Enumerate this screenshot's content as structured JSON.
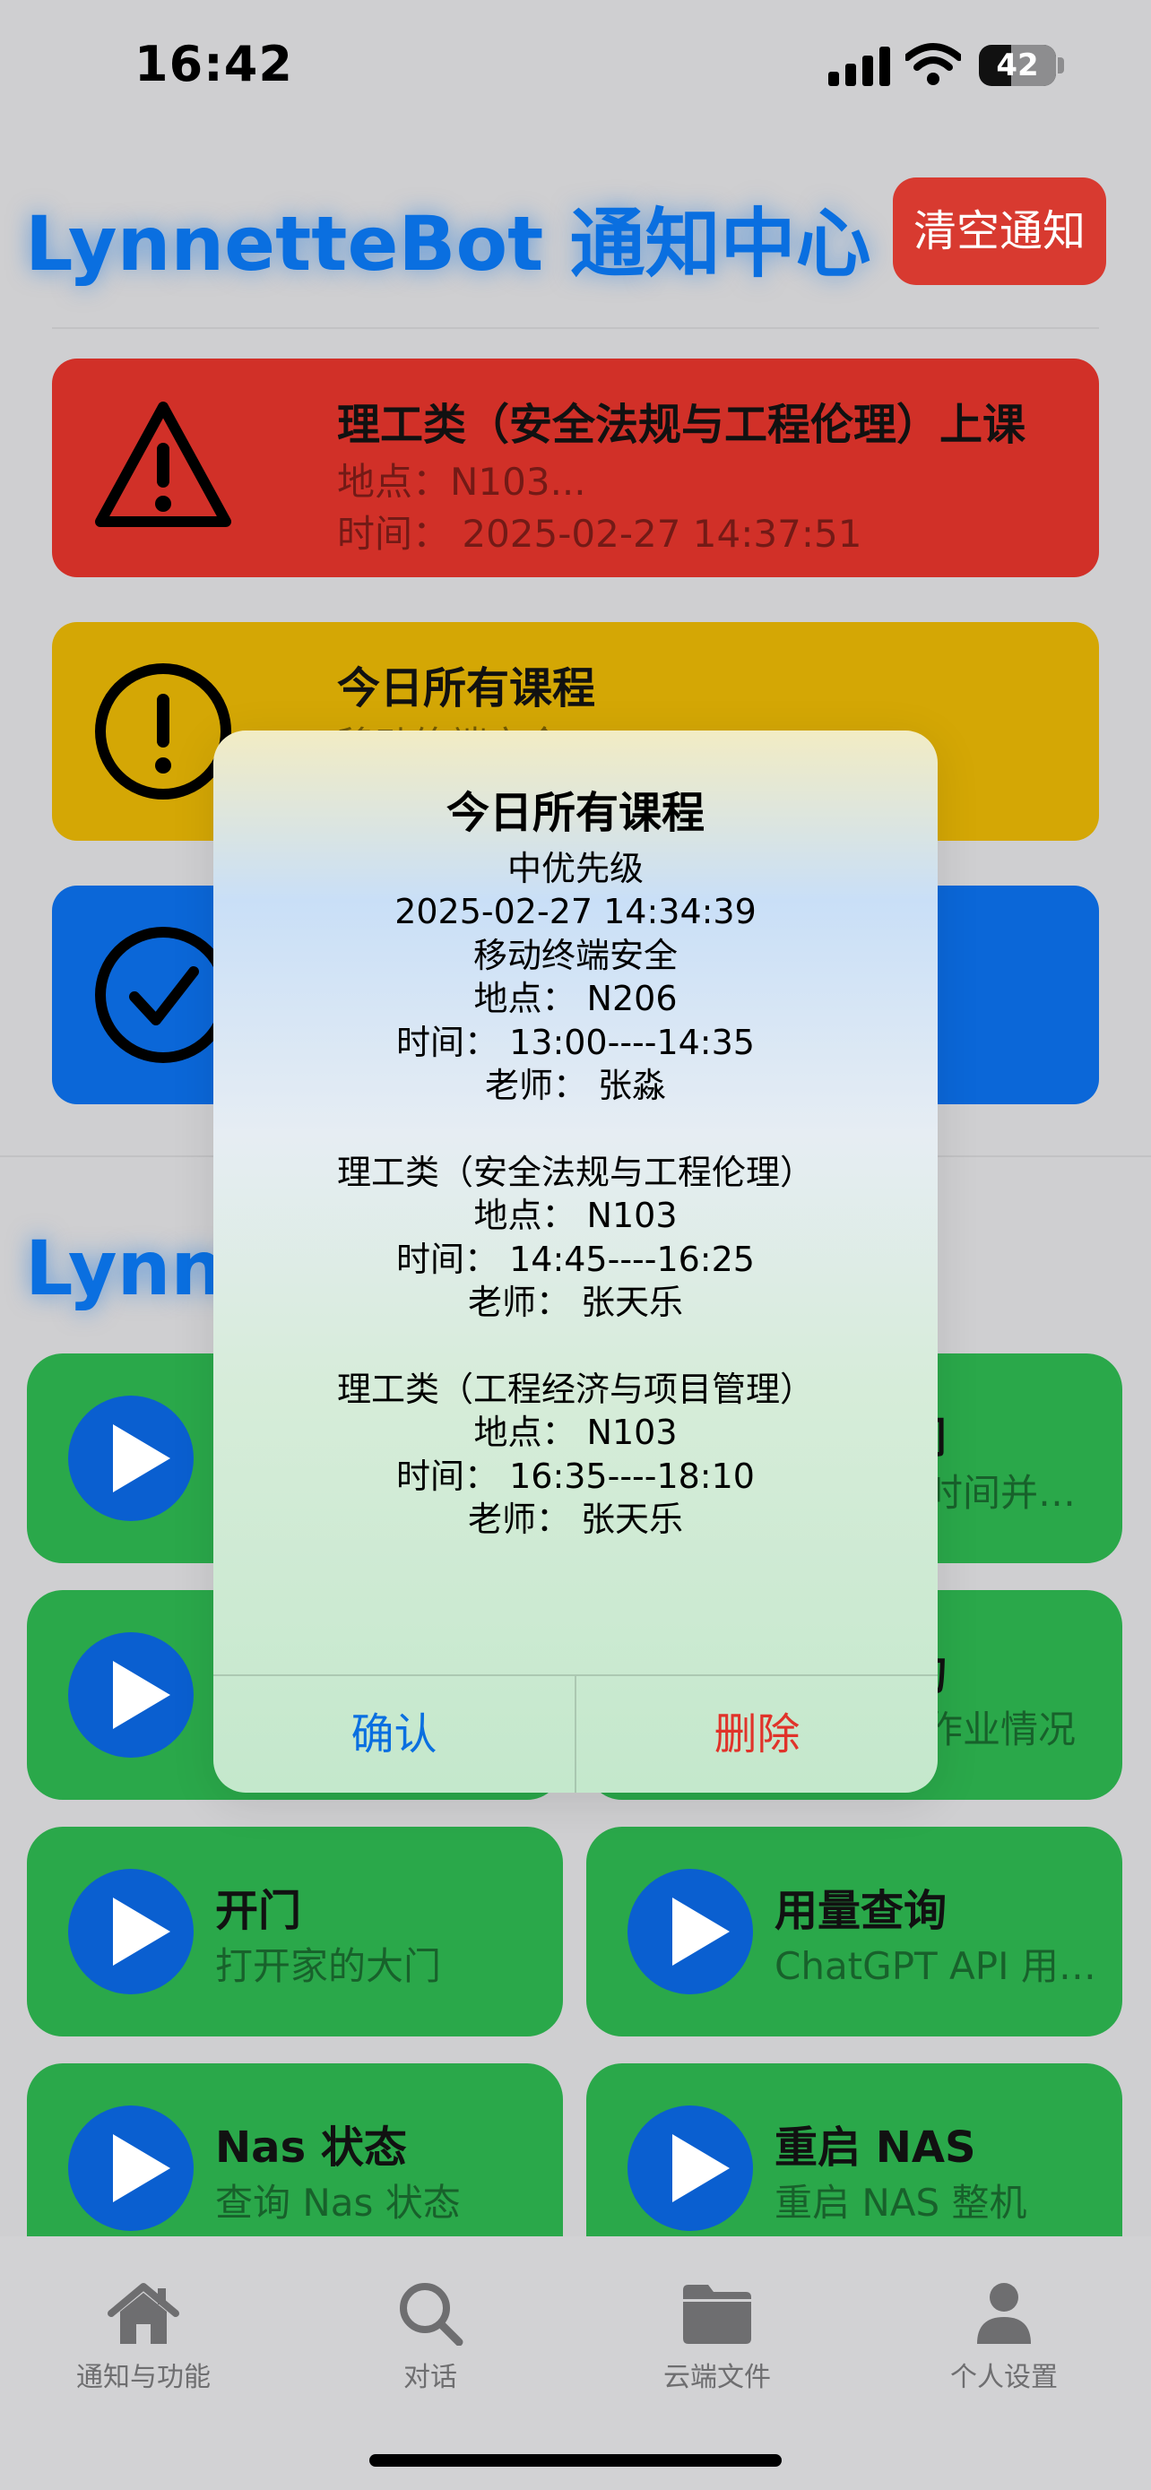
{
  "status_bar": {
    "time": "16:42",
    "battery": "42",
    "battery_level": 0.42
  },
  "header": {
    "title": "LynnetteBot 通知中心",
    "clear_button": "清空通知"
  },
  "notifications": [
    {
      "level": "critical",
      "icon": "warning-triangle-icon",
      "color": "#d13028",
      "title": "理工类（安全法规与工程伦理）上课",
      "subtitle": "地点：N103...",
      "time": "时间： 2025-02-27 14:37:51"
    },
    {
      "level": "medium",
      "icon": "exclamation-circle-icon",
      "color": "#d4a705",
      "title": "今日所有课程",
      "subtitle": "移动终端安全",
      "time": ""
    },
    {
      "level": "low",
      "icon": "checkmark-circle-icon",
      "color": "#0b67d8",
      "title": "",
      "subtitle": "",
      "time": ""
    }
  ],
  "features_section": {
    "title": "LynnetteBot 功能"
  },
  "features": [
    {
      "title": "",
      "subtitle": ""
    },
    {
      "title": "查询时间",
      "subtitle": "查询当前时间并返回"
    },
    {
      "title": "",
      "subtitle": ""
    },
    {
      "title": "作业查询",
      "subtitle": "查询当前作业情况"
    },
    {
      "title": "开门",
      "subtitle": "打开家的大门"
    },
    {
      "title": "用量查询",
      "subtitle": "ChatGPT API 用量查询"
    },
    {
      "title": "Nas 状态",
      "subtitle": "查询 Nas 状态"
    },
    {
      "title": "重启 NAS",
      "subtitle": "重启 NAS 整机"
    }
  ],
  "dialog": {
    "title": "今日所有课程",
    "lines": [
      "中优先级",
      "2025-02-27 14:34:39",
      "移动终端安全",
      "地点： N206",
      "时间： 13:00----14:35",
      "老师： 张淼",
      "",
      "理工类（安全法规与工程伦理）",
      "地点： N103",
      "时间： 14:45----16:25",
      "老师： 张天乐",
      "",
      "理工类（工程经济与项目管理）",
      "地点： N103",
      "时间： 16:35----18:10",
      "老师： 张天乐"
    ],
    "confirm": "确认",
    "delete": "删除"
  },
  "tab_bar": [
    {
      "label": "通知与功能",
      "icon": "house-icon",
      "active": true
    },
    {
      "label": "对话",
      "icon": "search-icon",
      "active": false
    },
    {
      "label": "云端文件",
      "icon": "folder-icon",
      "active": false
    },
    {
      "label": "个人设置",
      "icon": "person-icon",
      "active": false
    }
  ],
  "colors": {
    "accent": "#0a6fe0",
    "danger": "#d83a30",
    "feature_green": "#2aa84a",
    "play_blue": "#0a5fd0"
  }
}
